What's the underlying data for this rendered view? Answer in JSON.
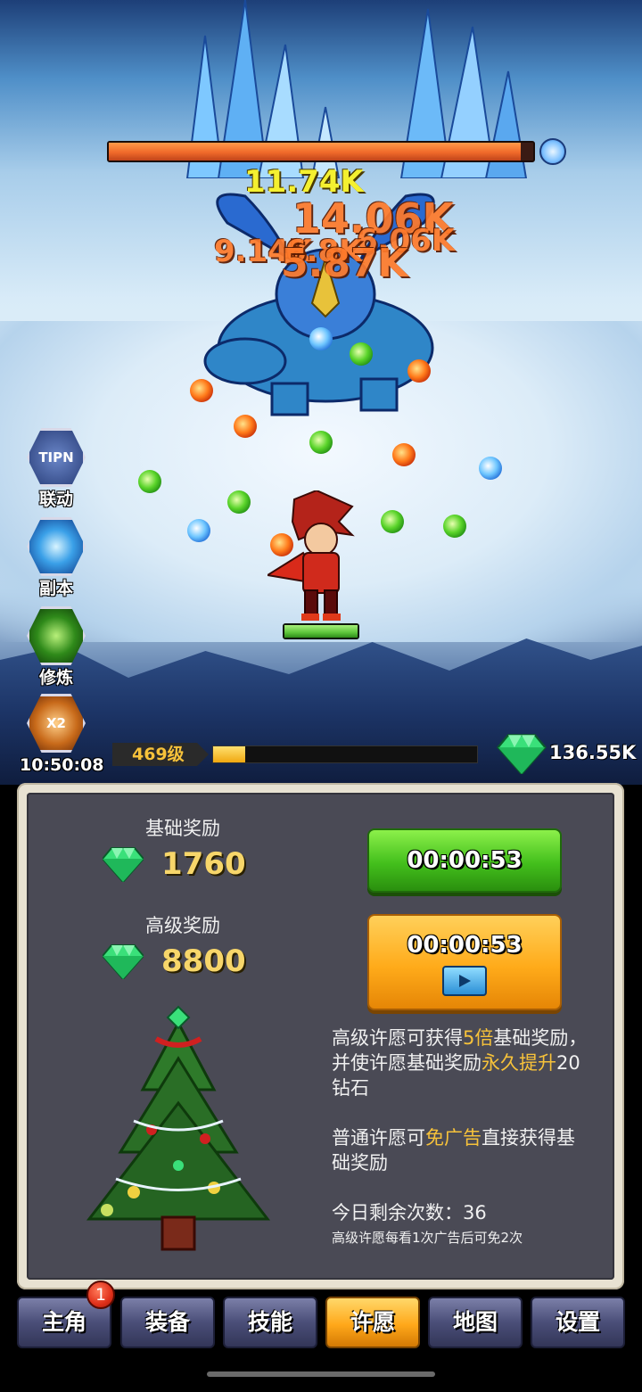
{
  "battle": {
    "boss_health": 0.97,
    "damage_numbers": [
      "11.74K",
      "14.06K",
      "9.14K",
      "6.8K",
      "6.06K",
      "5.87K"
    ],
    "hero_health": 1.0,
    "level_label": "469级",
    "level_progress": 0.12,
    "gem_total": "136.55K"
  },
  "side_menu": {
    "items": [
      {
        "label": "联动",
        "icon": "tipn-icon",
        "icon_text": "TIPN"
      },
      {
        "label": "副本",
        "icon": "vortex-icon",
        "icon_text": ""
      },
      {
        "label": "修炼",
        "icon": "green-spiral-icon",
        "icon_text": ""
      },
      {
        "label": "10:50:08",
        "icon": "bag-x2-icon",
        "icon_text": "X2"
      }
    ]
  },
  "wish": {
    "basic": {
      "title": "基础奖励",
      "value": "1760",
      "timer": "00:00:53"
    },
    "advanced": {
      "title": "高级奖励",
      "value": "8800",
      "timer": "00:00:53"
    },
    "desc1": {
      "p1": "高级许愿可获得",
      "h1": "5倍",
      "p2": "基础奖励，并使许愿基础奖励",
      "h2": "永久提升",
      "p3": "20钻石"
    },
    "desc2": {
      "p1": "普通许愿可",
      "h1": "免广告",
      "p2": "直接获得基础奖励"
    },
    "remaining": "今日剩余次数：36",
    "note": "高级许愿每看1次广告后可免2次"
  },
  "tabs": {
    "items": [
      "主角",
      "装备",
      "技能",
      "许愿",
      "地图",
      "设置"
    ],
    "active_index": 3,
    "badge": "1"
  },
  "colors": {
    "gold_text": "#f7c23a",
    "green_button": "#43bf1c",
    "orange_button": "#ffab1a",
    "panel_bg": "#4a4a55"
  }
}
